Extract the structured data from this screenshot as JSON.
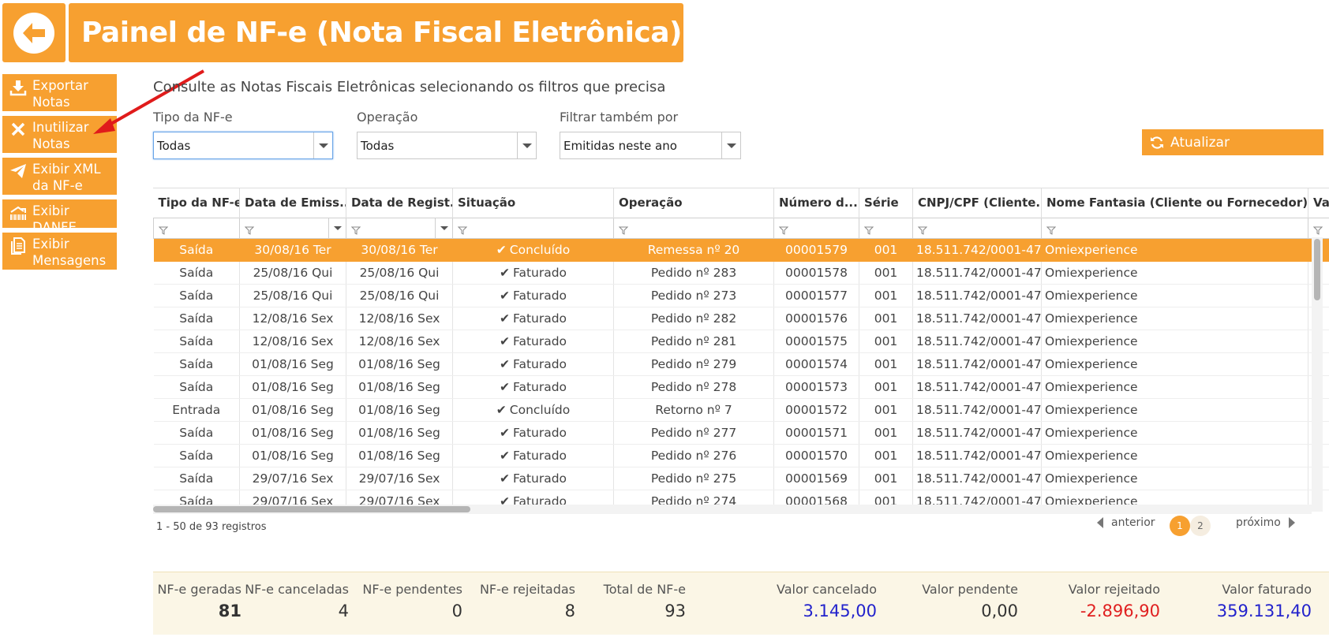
{
  "header": {
    "title": "Painel de NF-e (Nota Fiscal Eletrônica)"
  },
  "sidebar": {
    "items": [
      {
        "label": "Exportar\nNotas Fiscais",
        "icon": "download-icon"
      },
      {
        "label": "Inutilizar\nNotas Fiscais",
        "icon": "x-icon"
      },
      {
        "label": "Exibir XML\nda NF-e",
        "icon": "paper-plane-icon"
      },
      {
        "label": "Exibir DANFE",
        "icon": "barcode-icon"
      },
      {
        "label": "Exibir\nMensagens",
        "icon": "document-icon"
      }
    ]
  },
  "subtitle": "Consulte as Notas Fiscais Eletrônicas selecionando os filtros que precisa",
  "filters": {
    "tipo": {
      "label": "Tipo da NF-e",
      "value": "Todas"
    },
    "operacao": {
      "label": "Operação",
      "value": "Todas"
    },
    "filtrar": {
      "label": "Filtrar também por",
      "value": "Emitidas neste ano"
    }
  },
  "refresh_label": "Atualizar",
  "grid": {
    "columns": [
      "Tipo da NF-e",
      "Data de Emiss...",
      "Data de Regist...",
      "Situação",
      "Operação",
      "Número d...",
      "Série",
      "CNPJ/CPF (Cliente...",
      "Nome Fantasia (Cliente ou Fornecedor)",
      "Va"
    ],
    "rows": [
      [
        "Saída",
        "30/08/16 Ter",
        "30/08/16 Ter",
        "Concluído",
        "Remessa nº 20",
        "00001579",
        "001",
        "18.511.742/0001-47",
        "Omiexperience"
      ],
      [
        "Saída",
        "25/08/16 Qui",
        "25/08/16 Qui",
        "Faturado",
        "Pedido nº 283",
        "00001578",
        "001",
        "18.511.742/0001-47",
        "Omiexperience"
      ],
      [
        "Saída",
        "25/08/16 Qui",
        "25/08/16 Qui",
        "Faturado",
        "Pedido nº 273",
        "00001577",
        "001",
        "18.511.742/0001-47",
        "Omiexperience"
      ],
      [
        "Saída",
        "12/08/16 Sex",
        "12/08/16 Sex",
        "Faturado",
        "Pedido nº 282",
        "00001576",
        "001",
        "18.511.742/0001-47",
        "Omiexperience"
      ],
      [
        "Saída",
        "12/08/16 Sex",
        "12/08/16 Sex",
        "Faturado",
        "Pedido nº 281",
        "00001575",
        "001",
        "18.511.742/0001-47",
        "Omiexperience"
      ],
      [
        "Saída",
        "01/08/16 Seg",
        "01/08/16 Seg",
        "Faturado",
        "Pedido nº 279",
        "00001574",
        "001",
        "18.511.742/0001-47",
        "Omiexperience"
      ],
      [
        "Saída",
        "01/08/16 Seg",
        "01/08/16 Seg",
        "Faturado",
        "Pedido nº 278",
        "00001573",
        "001",
        "18.511.742/0001-47",
        "Omiexperience"
      ],
      [
        "Entrada",
        "01/08/16 Seg",
        "01/08/16 Seg",
        "Concluído",
        "Retorno nº 7",
        "00001572",
        "001",
        "18.511.742/0001-47",
        "Omiexperience"
      ],
      [
        "Saída",
        "01/08/16 Seg",
        "01/08/16 Seg",
        "Faturado",
        "Pedido nº 277",
        "00001571",
        "001",
        "18.511.742/0001-47",
        "Omiexperience"
      ],
      [
        "Saída",
        "01/08/16 Seg",
        "01/08/16 Seg",
        "Faturado",
        "Pedido nº 276",
        "00001570",
        "001",
        "18.511.742/0001-47",
        "Omiexperience"
      ],
      [
        "Saída",
        "29/07/16 Sex",
        "29/07/16 Sex",
        "Faturado",
        "Pedido nº 275",
        "00001569",
        "001",
        "18.511.742/0001-47",
        "Omiexperience"
      ],
      [
        "Saída",
        "29/07/16 Sex",
        "29/07/16 Sex",
        "Faturado",
        "Pedido nº 274",
        "00001568",
        "001",
        "18.511.742/0001-47",
        "Omiexperience"
      ]
    ]
  },
  "pager": {
    "records": "1 - 50 de 93 registros",
    "prev": "anterior",
    "next": "próximo",
    "pages": [
      "1",
      "2"
    ]
  },
  "summary": {
    "geradas": {
      "label": "NF-e geradas",
      "value": "81"
    },
    "canceladas": {
      "label": "NF-e canceladas",
      "value": "4"
    },
    "pendentes": {
      "label": "NF-e pendentes",
      "value": "0"
    },
    "rejeitadas": {
      "label": "NF-e rejeitadas",
      "value": "8"
    },
    "total": {
      "label": "Total de NF-e",
      "value": "93"
    },
    "valor_cancelado": {
      "label": "Valor cancelado",
      "value": "3.145,00"
    },
    "valor_pendente": {
      "label": "Valor pendente",
      "value": "0,00"
    },
    "valor_rejeitado": {
      "label": "Valor rejeitado",
      "value": "-2.896,90"
    },
    "valor_faturado": {
      "label": "Valor faturado",
      "value": "359.131,40"
    }
  },
  "colors": {
    "accent": "#f7a030",
    "blue": "#2222cc",
    "red": "#e02020"
  }
}
